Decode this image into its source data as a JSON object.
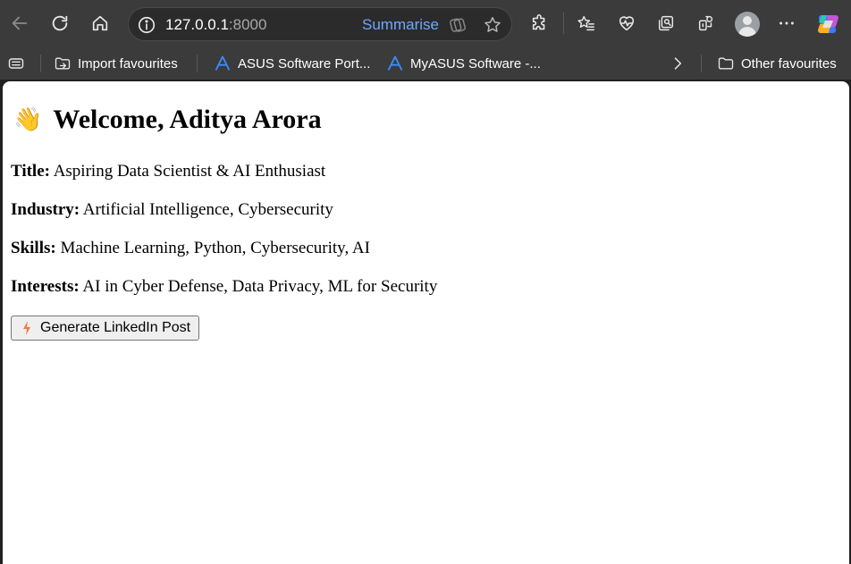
{
  "browser": {
    "url_host": "127.0.0.1",
    "url_port": ":8000",
    "summarise_label": "Summarise",
    "bookmarks": [
      {
        "label": "Import favourites",
        "icon": "import-icon"
      },
      {
        "label": "ASUS Software Port...",
        "icon": "asus-logo-icon"
      },
      {
        "label": "MyASUS Software -...",
        "icon": "asus-logo-icon"
      },
      {
        "label": "Other favourites",
        "icon": "folder-icon"
      }
    ],
    "accent_color": "#6ea8ff"
  },
  "page": {
    "greeting_icon": "👋",
    "greeting": "Welcome, Aditya Arora",
    "fields": [
      {
        "label": "Title:",
        "value": "Aspiring Data Scientist & AI Enthusiast"
      },
      {
        "label": "Industry:",
        "value": "Artificial Intelligence, Cybersecurity"
      },
      {
        "label": "Skills:",
        "value": "Machine Learning, Python, Cybersecurity, AI"
      },
      {
        "label": "Interests:",
        "value": "AI in Cyber Defense, Data Privacy, ML for Security"
      }
    ],
    "generate_button_icon": "lightning-icon",
    "generate_button_label": "Generate LinkedIn Post"
  }
}
